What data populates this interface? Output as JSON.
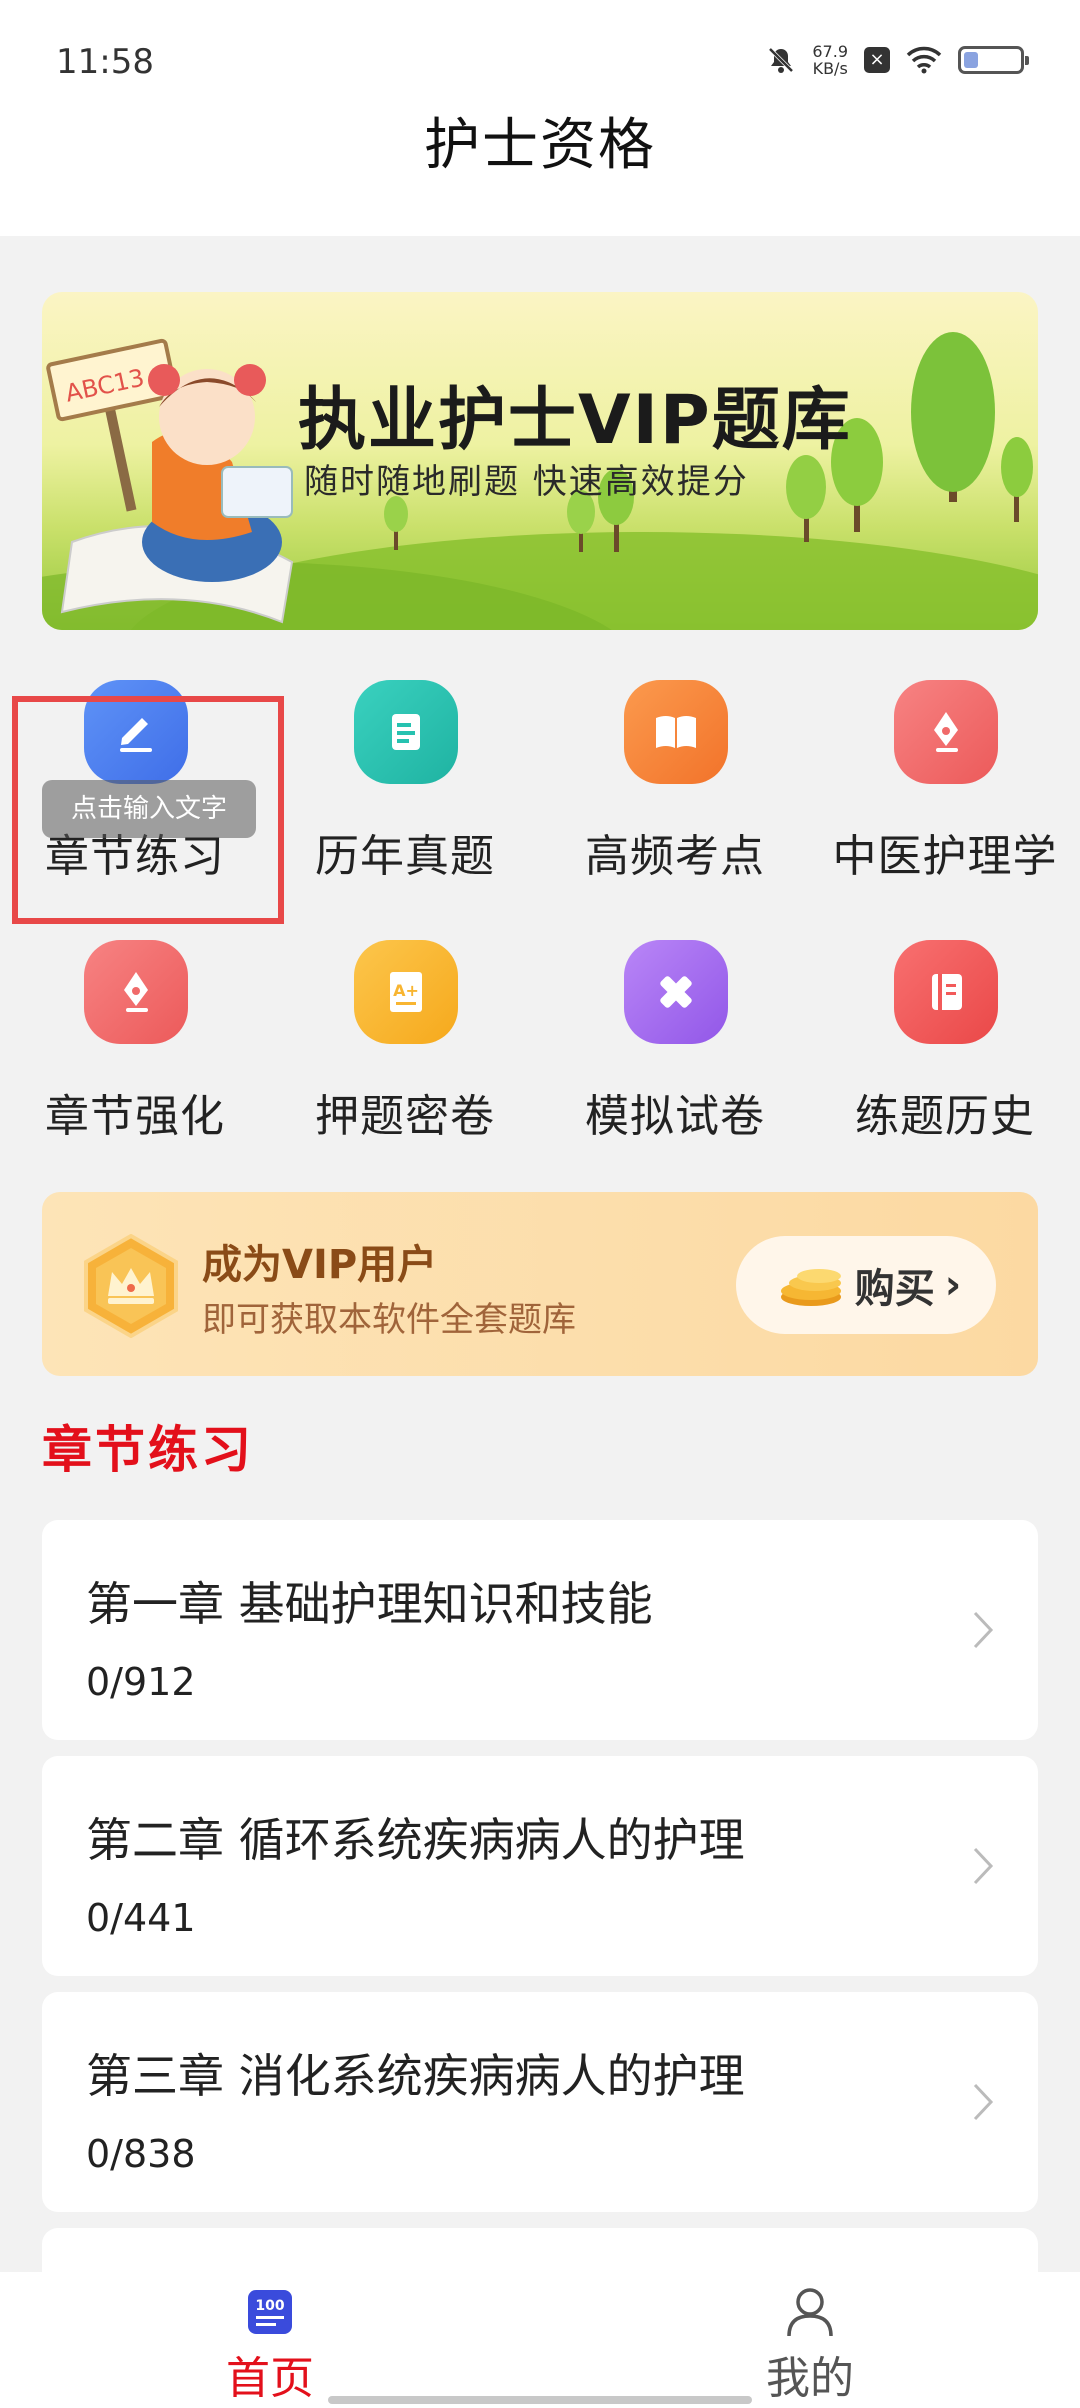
{
  "status_bar": {
    "time": "11:58",
    "net_speed_value": "67.9",
    "net_speed_unit": "KB/s",
    "battery_level": 0.25,
    "icons": [
      "mute-icon",
      "close-notification-icon",
      "wifi-icon",
      "battery-icon"
    ]
  },
  "header": {
    "title": "护士资格"
  },
  "banner": {
    "title": "执业护士VIP题库",
    "subtitle": "随时随地刷题 快速高效提分",
    "sign_text": "ABC13"
  },
  "grid": {
    "items": [
      {
        "label": "章节练习",
        "icon": "pencil-icon",
        "color": "#4a7ff2"
      },
      {
        "label": "历年真题",
        "icon": "document-icon",
        "color": "#26c2b0"
      },
      {
        "label": "高频考点",
        "icon": "book-icon",
        "color": "#f58a3c"
      },
      {
        "label": "中医护理学",
        "icon": "pen-nib-icon",
        "color": "#f06a6a"
      },
      {
        "label": "章节强化",
        "icon": "pen-nib-icon",
        "color": "#f06a6a"
      },
      {
        "label": "押题密卷",
        "icon": "exam-paper-icon",
        "color": "#f8b531"
      },
      {
        "label": "模拟试卷",
        "icon": "ruler-pencil-icon",
        "color": "#a36df0"
      },
      {
        "label": "练题历史",
        "icon": "notebook-icon",
        "color": "#f25a5a"
      }
    ],
    "tooltip": "点击输入文字"
  },
  "vip": {
    "title": "成为VIP用户",
    "subtitle": "即可获取本软件全套题库",
    "buy_label": "购买",
    "buy_arrow": "›"
  },
  "section": {
    "title": "章节练习"
  },
  "chapters": [
    {
      "title": "第一章 基础护理知识和技能",
      "progress": "0/912"
    },
    {
      "title": "第二章 循环系统疾病病人的护理",
      "progress": "0/441"
    },
    {
      "title": "第三章 消化系统疾病病人的护理",
      "progress": "0/838"
    }
  ],
  "bottom_nav": {
    "home_label": "首页",
    "home_icon_text": "100",
    "me_label": "我的",
    "active": "home",
    "accent": "#e3101b"
  }
}
